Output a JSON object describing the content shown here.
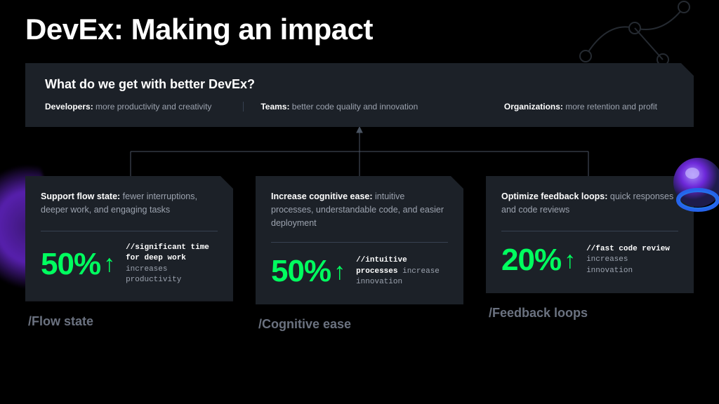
{
  "title": "DevEx: Making an impact",
  "top_panel": {
    "heading": "What do we get with better DevEx?",
    "benefits": [
      {
        "label": "Developers:",
        "text": " more productivity and creativity"
      },
      {
        "label": "Teams:",
        "text": " better code quality and innovation"
      },
      {
        "label": "Organizations:",
        "text": " more retention and profit"
      }
    ]
  },
  "cards": [
    {
      "heading_label": "Support flow state:",
      "heading_text": " fewer interruptions, deeper work, and engaging tasks",
      "stat_value": "50%",
      "caption_bold": "//significant time for deep work",
      "caption_rest": " increases productivity",
      "tag": "/Flow state"
    },
    {
      "heading_label": "Increase cognitive ease:",
      "heading_text": " intuitive processes, understandable code, and easier deployment",
      "stat_value": "50%",
      "caption_bold": "//intuitive processes",
      "caption_rest": " increase innovation",
      "tag": "/Cognitive ease"
    },
    {
      "heading_label": "Optimize feedback loops:",
      "heading_text": " quick responses and code reviews",
      "stat_value": "20%",
      "caption_bold": "//fast code review",
      "caption_rest": " increases innovation",
      "tag": "/Feedback loops"
    }
  ],
  "colors": {
    "accent_green": "#00ff5f",
    "panel_bg": "#1c2128",
    "muted_text": "#9ca3af"
  }
}
